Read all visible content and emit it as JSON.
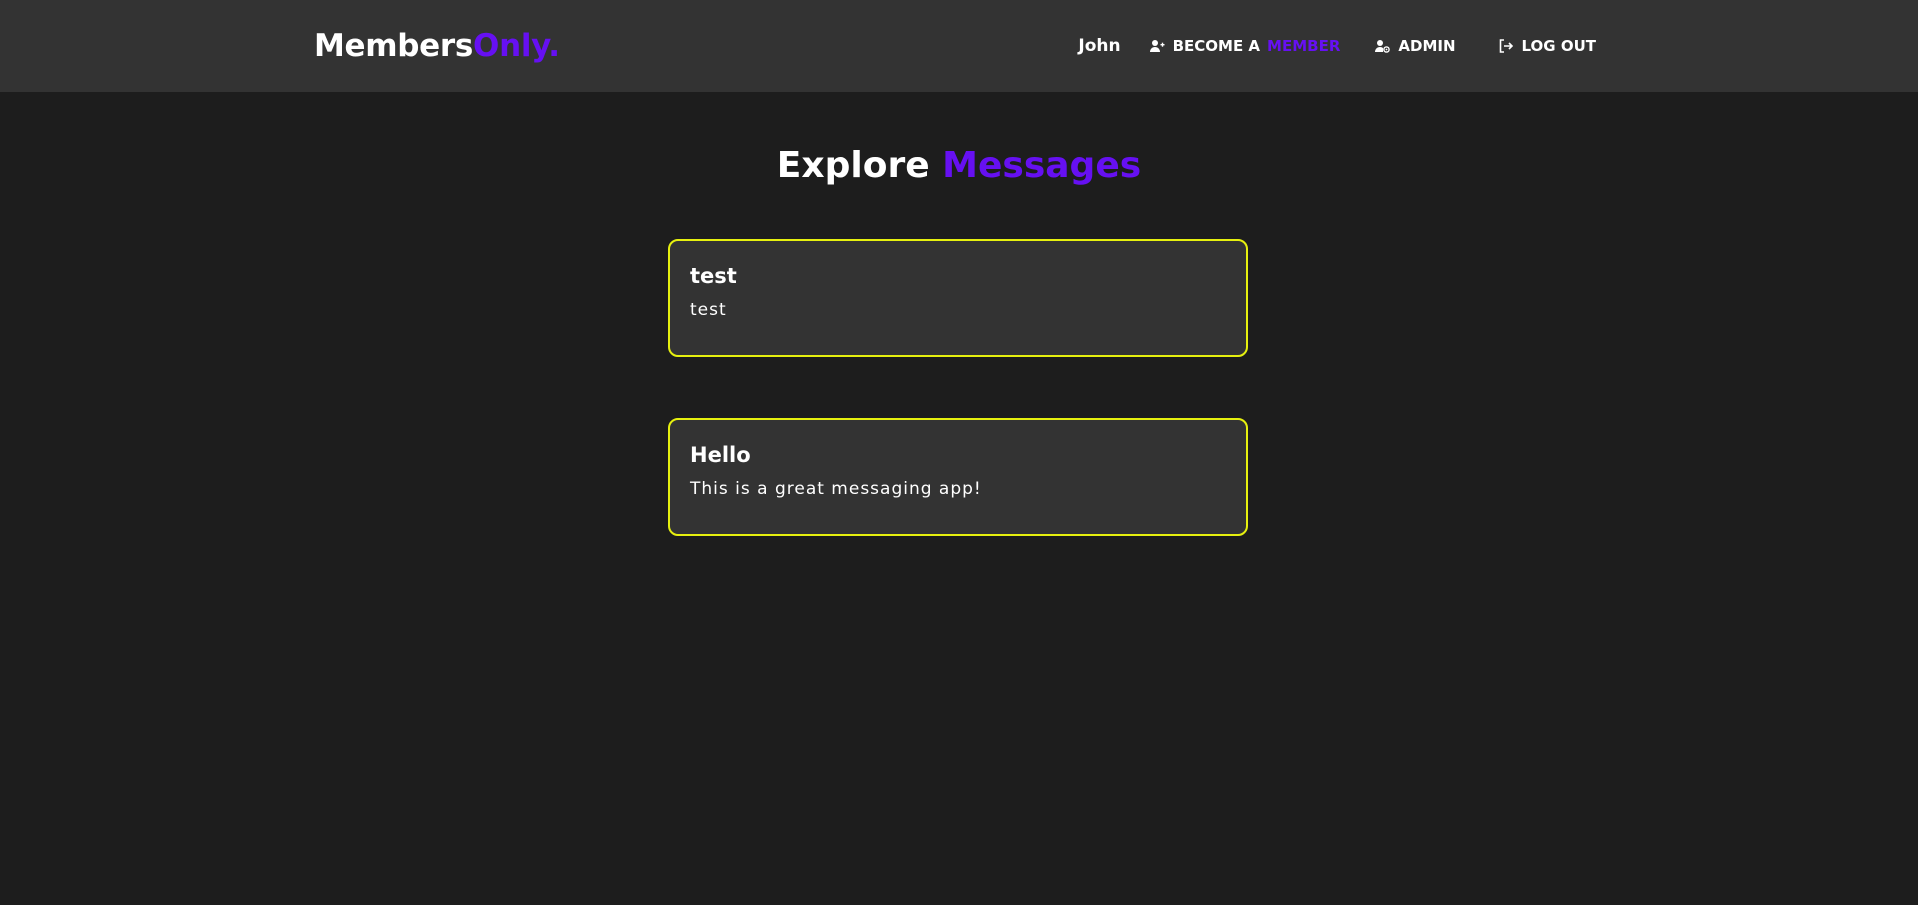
{
  "brand": {
    "name": "Members",
    "accent": "Only."
  },
  "nav": {
    "user": "John",
    "become_member": {
      "icon": "user-plus-icon",
      "label": "BECOME A",
      "highlight": "MEMBER"
    },
    "admin": {
      "icon": "user-gear-icon",
      "label": "ADMIN"
    },
    "logout": {
      "icon": "logout-icon",
      "label": "LOG OUT"
    }
  },
  "page": {
    "title": "Explore",
    "title_accent": "Messages"
  },
  "messages": [
    {
      "title": "test",
      "body": "test"
    },
    {
      "title": "Hello",
      "body": "This is a great messaging app!"
    }
  ],
  "colors": {
    "background": "#1d1d1d",
    "surface": "#333333",
    "accent": "#6610f2",
    "card_border": "#e6f00f",
    "text": "#ffffff"
  }
}
